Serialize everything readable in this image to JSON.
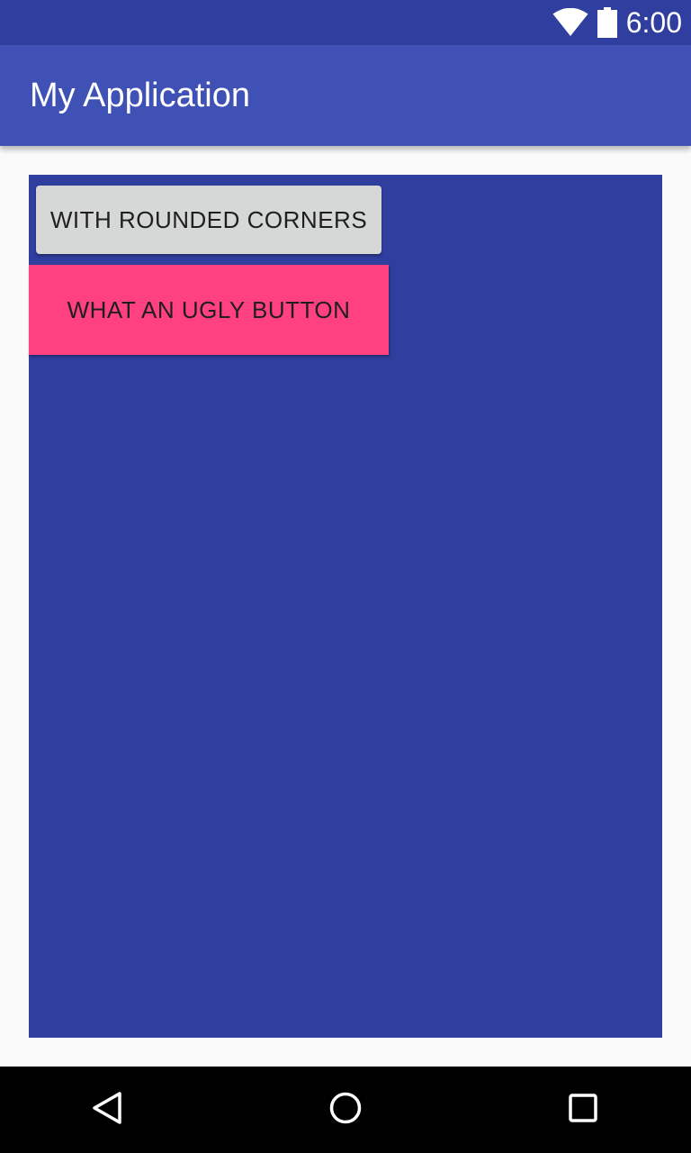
{
  "status_bar": {
    "time": "6:00",
    "icons": [
      "wifi-icon",
      "battery-icon"
    ],
    "background": "#303f9f"
  },
  "app_bar": {
    "title": "My Application",
    "background": "#3f51b5"
  },
  "content": {
    "panel_color": "#303f9f",
    "buttons": {
      "rounded": {
        "label": "WITH ROUNDED CORNERS",
        "background": "#d6d7d7"
      },
      "ugly": {
        "label": "WHAT AN UGLY BUTTON",
        "background": "#ff4081"
      }
    }
  },
  "nav_bar": {
    "icons": [
      "back-icon",
      "home-icon",
      "recents-icon"
    ]
  }
}
